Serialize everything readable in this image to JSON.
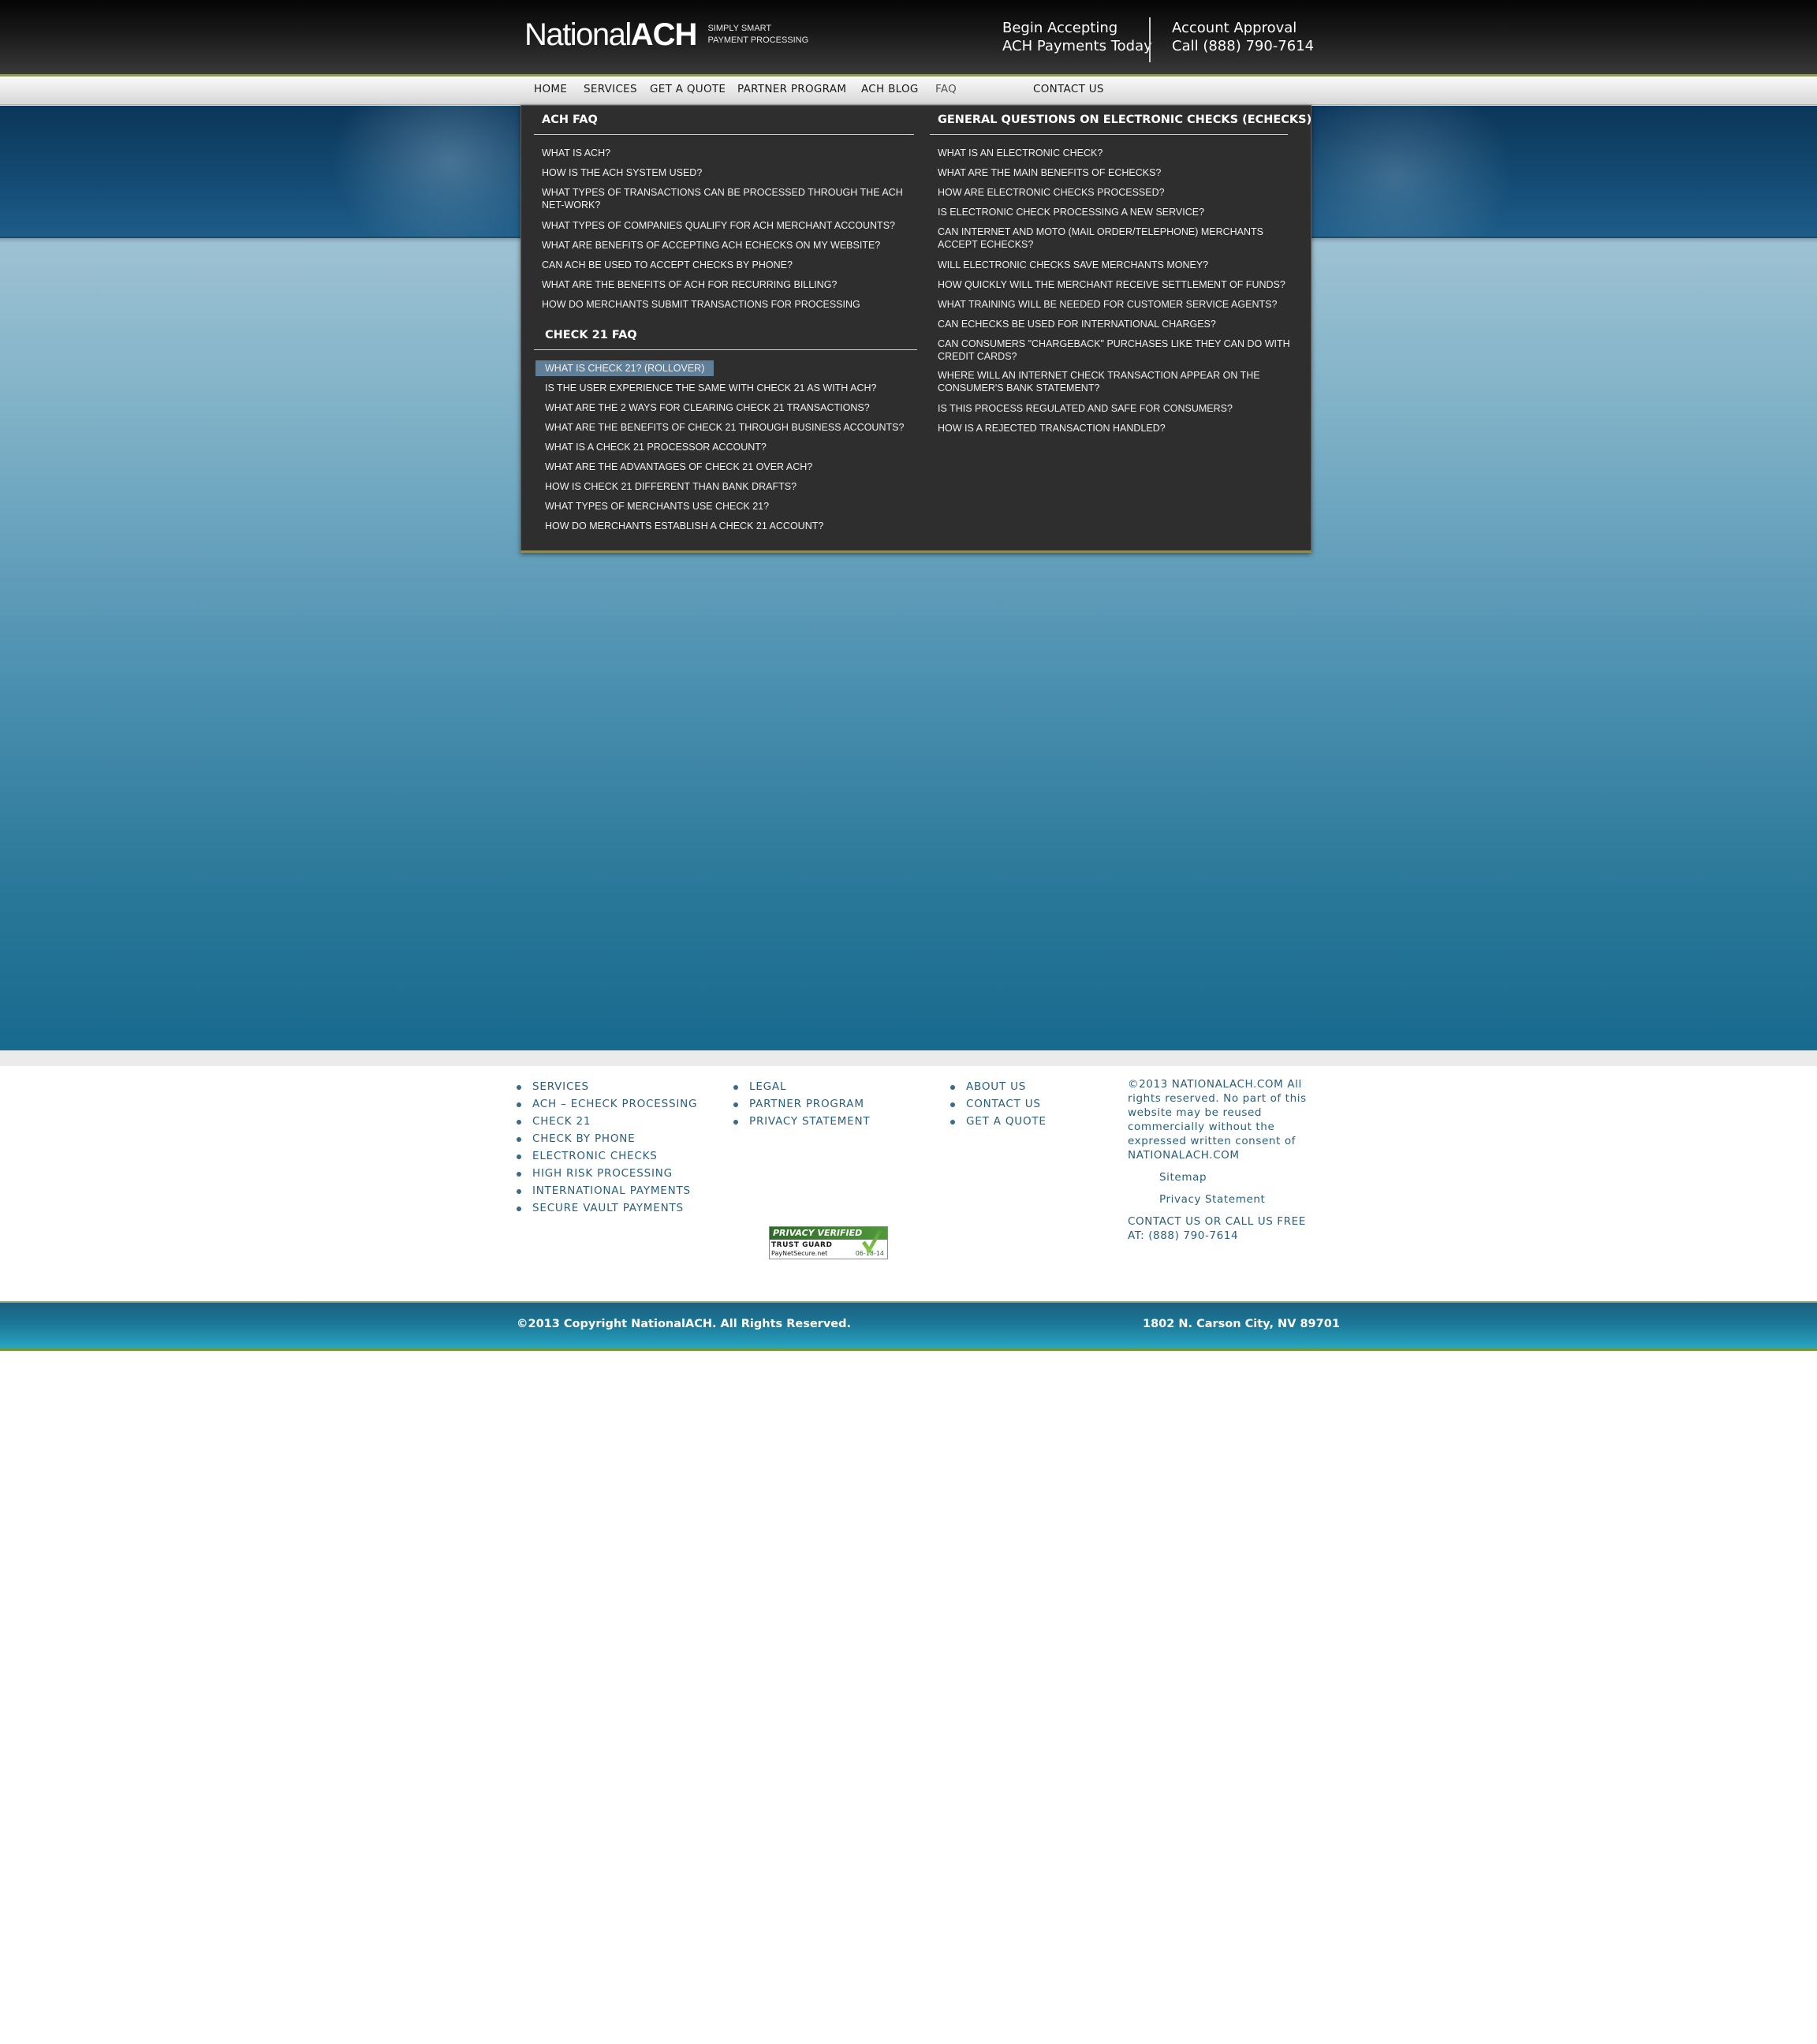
{
  "header": {
    "logo_light": "National",
    "logo_bold": "ACH",
    "tagline_line1": "SIMPLY SMART",
    "tagline_line2": "PAYMENT PROCESSING",
    "cta1_line1": "Begin Accepting",
    "cta1_line2": "ACH Payments Today",
    "cta2_line1": "Account Approval",
    "cta2_line2": "Call (888) 790-7614"
  },
  "nav": {
    "items": [
      "HOME",
      "SERVICES",
      "GET A QUOTE",
      "PARTNER PROGRAM",
      "ACH BLOG",
      "FAQ",
      "CONTACT US"
    ],
    "active": "FAQ"
  },
  "faq_menu": {
    "ach_faq": {
      "title": "ACH FAQ",
      "items": [
        "WHAT IS ACH?",
        "HOW IS THE ACH SYSTEM USED?",
        "WHAT TYPES OF TRANSACTIONS CAN BE PROCESSED THROUGH THE ACH NET-WORK?",
        "WHAT TYPES OF COMPANIES QUALIFY FOR ACH MERCHANT ACCOUNTS?",
        "WHAT ARE BENEFITS OF ACCEPTING ACH ECHECKS ON MY WEBSITE?",
        "CAN ACH BE USED TO ACCEPT CHECKS BY PHONE?",
        "WHAT ARE THE BENEFITS OF ACH FOR RECURRING BILLING?",
        "HOW DO MERCHANTS SUBMIT TRANSACTIONS FOR PROCESSING"
      ]
    },
    "check21_faq": {
      "title": "CHECK 21 FAQ",
      "items": [
        "WHAT IS CHECK 21? (ROLLOVER)",
        "IS THE USER EXPERIENCE THE SAME WITH CHECK 21 AS WITH ACH?",
        "WHAT ARE THE 2 WAYS FOR CLEARING CHECK 21 TRANSACTIONS?",
        "WHAT ARE THE BENEFITS OF CHECK 21 THROUGH BUSINESS ACCOUNTS?",
        "WHAT IS A CHECK 21 PROCESSOR ACCOUNT?",
        "WHAT ARE THE ADVANTAGES OF CHECK 21 OVER ACH?",
        "HOW IS CHECK 21 DIFFERENT THAN BANK DRAFTS?",
        "WHAT TYPES OF MERCHANTS USE CHECK 21?",
        "HOW DO MERCHANTS ESTABLISH A CHECK 21 ACCOUNT?"
      ],
      "highlighted_index": 0
    },
    "echeck_faq": {
      "title": "GENERAL QUESTIONS ON ELECTRONIC CHECKS (ECHECKS)",
      "items": [
        "WHAT IS AN ELECTRONIC CHECK?",
        "WHAT ARE THE MAIN BENEFITS OF ECHECKS?",
        "HOW ARE ELECTRONIC CHECKS PROCESSED?",
        "IS ELECTRONIC CHECK PROCESSING A NEW SERVICE?",
        "CAN INTERNET AND MOTO (MAIL ORDER/TELEPHONE) MERCHANTS ACCEPT ECHECKS?",
        "WILL ELECTRONIC CHECKS SAVE MERCHANTS MONEY?",
        "HOW QUICKLY WILL THE MERCHANT RECEIVE SETTLEMENT OF FUNDS?",
        "WHAT TRAINING WILL BE NEEDED FOR CUSTOMER SERVICE AGENTS?",
        "CAN ECHECKS BE USED FOR INTERNATIONAL CHARGES?",
        "CAN CONSUMERS \"CHARGEBACK\" PURCHASES LIKE THEY CAN DO WITH CREDIT CARDS?",
        "WHERE WILL AN INTERNET CHECK TRANSACTION APPEAR ON THE CONSUMER'S BANK STATEMENT?",
        "IS THIS PROCESS REGULATED AND SAFE FOR CONSUMERS?",
        "HOW IS A REJECTED TRANSACTION HANDLED?"
      ]
    }
  },
  "footer": {
    "col1": [
      "SERVICES",
      "ACH – ECHECK PROCESSING",
      "CHECK 21",
      "CHECK BY PHONE",
      "ELECTRONIC CHECKS",
      "HIGH RISK PROCESSING",
      "INTERNATIONAL PAYMENTS",
      "SECURE VAULT PAYMENTS"
    ],
    "col2": [
      "LEGAL",
      "PARTNER PROGRAM",
      "PRIVACY STATEMENT"
    ],
    "col3": [
      "ABOUT US",
      "CONTACT US",
      "GET A QUOTE"
    ],
    "copyright_block": "©2013 NATIONALACH.COM All rights reserved. No part of this website may be reused commercially without the expressed written consent of NATIONALACH.COM",
    "sitemap": "Sitemap",
    "privacy": "Privacy Statement",
    "contact_line": "CONTACT US OR CALL US FREE AT: (888) 790-7614",
    "badge": {
      "line1": "PRIVACY VERIFIED",
      "line2": "TRUST GUARD",
      "line3": "PayNetSecure.net",
      "date": "06-18-14"
    }
  },
  "bottom_bar": {
    "copyright": "©2013 Copyright NationalACH. All Rights Reserved.",
    "address": "1802 N. Carson City, NV 89701"
  },
  "colors": {
    "header_bg": "#1a1a1a",
    "menu_bg": "#2e2e2e",
    "highlight": "#5f7f99",
    "footer_link": "#2b5f78",
    "bottom_bar": "#1c7898"
  }
}
